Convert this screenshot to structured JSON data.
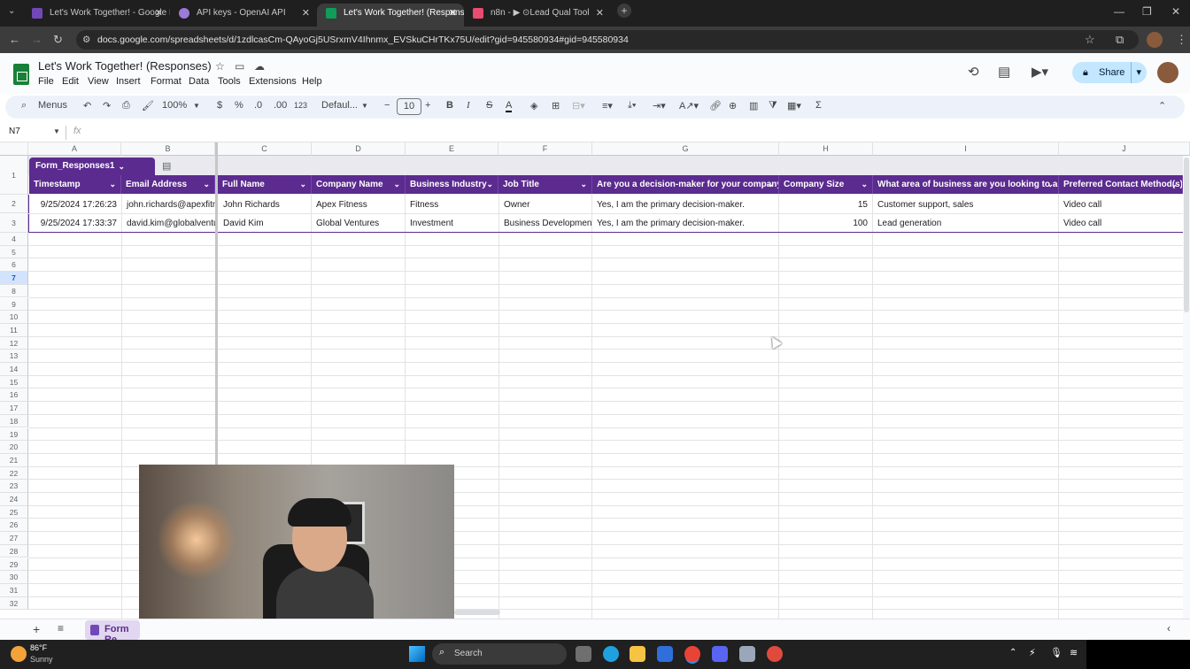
{
  "browser": {
    "tabs": [
      {
        "title": "Let's Work Together! - Google F",
        "color": "#7248b9"
      },
      {
        "title": "API keys - OpenAI API",
        "color": "#9a7bd8"
      },
      {
        "title": "Let's Work Together! (Response",
        "color": "#0f9d58"
      },
      {
        "title": "n8n - ▶ ⊙Lead Qual Tool",
        "color": "#ea4b71"
      }
    ],
    "url": "docs.google.com/spreadsheets/d/1zdlcasCm-QAyoGj5USrxmV4Ihnmx_EVSkuCHrTKx75U/edit?gid=945580934#gid=945580934"
  },
  "doc": {
    "title": "Let's Work Together! (Responses)",
    "menus": [
      "File",
      "Edit",
      "View",
      "Insert",
      "Format",
      "Data",
      "Tools",
      "Extensions",
      "Help"
    ],
    "share_label": "Share"
  },
  "toolbar": {
    "menus_label": "Menus",
    "zoom": "100%",
    "currency": "$",
    "percent": "%",
    "dec_decrease": ".0",
    "dec_increase": ".00",
    "number_format": "123",
    "font": "Defaul...",
    "font_size": "10"
  },
  "formula": {
    "name_box": "N7",
    "fx": "fx"
  },
  "sheet": {
    "col_letters": [
      "A",
      "B",
      "C",
      "D",
      "E",
      "F",
      "G",
      "H",
      "I",
      "J"
    ],
    "table_name": "Form_Responses1",
    "headers": [
      "Timestamp",
      "Email Address",
      "Full Name",
      "Company Name",
      "Business Industry",
      "Job Title",
      "Are you a decision-maker for your company's",
      "Company Size",
      "What area of business are you looking to auto",
      "Preferred Contact Method(s)"
    ],
    "rows": [
      [
        "9/25/2024 17:26:23",
        "john.richards@apexfitne",
        "John Richards",
        "Apex Fitness",
        "Fitness",
        "Owner",
        "Yes, I am the primary decision-maker.",
        "15",
        "Customer support, sales",
        "Video call"
      ],
      [
        "9/25/2024 17:33:37",
        "david.kim@globalventur",
        "David Kim",
        "Global Ventures",
        "Investment",
        "Business Development I",
        "Yes, I am the primary decision-maker.",
        "100",
        "Lead generation",
        "Video call"
      ]
    ],
    "row_numbers": [
      "1",
      "2",
      "3",
      "4",
      "5",
      "6",
      "7",
      "8",
      "9",
      "10",
      "11",
      "12",
      "13",
      "14",
      "15",
      "16",
      "17",
      "18",
      "19",
      "20",
      "21",
      "22",
      "23",
      "24",
      "25",
      "26",
      "27",
      "28",
      "29",
      "30",
      "31",
      "32"
    ],
    "sheet_tab": "Form Re"
  },
  "taskbar": {
    "temp": "86°F",
    "weather": "Sunny",
    "search": "Search"
  }
}
